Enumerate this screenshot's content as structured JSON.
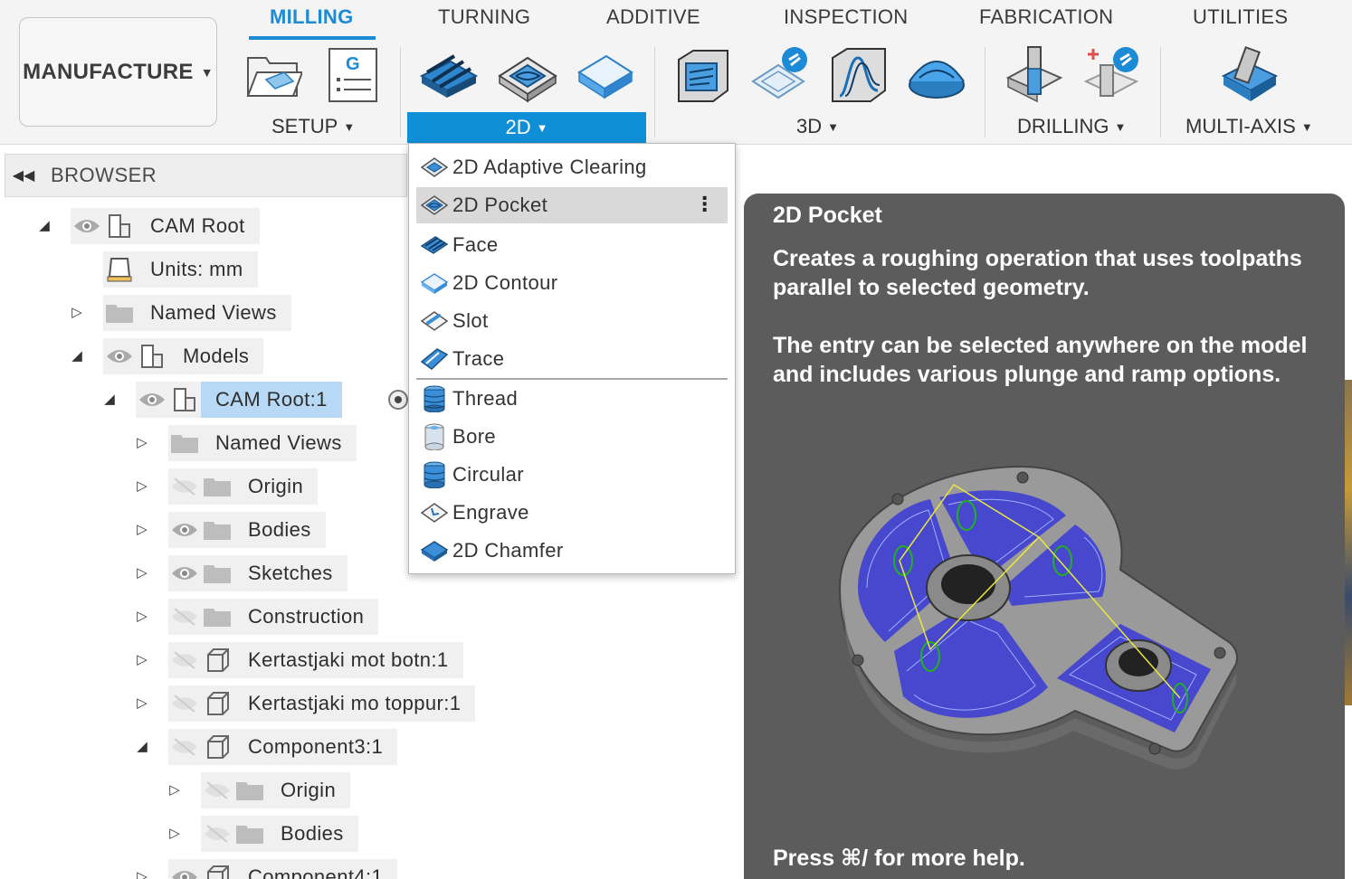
{
  "toolbar": {
    "workspace": "MANUFACTURE",
    "tabs": [
      "MILLING",
      "TURNING",
      "ADDITIVE",
      "INSPECTION",
      "FABRICATION",
      "UTILITIES"
    ],
    "active_tab": "MILLING",
    "groups": {
      "setup": "SETUP",
      "two_d": "2D",
      "three_d": "3D",
      "drilling": "DRILLING",
      "multi_axis": "MULTI-AXIS"
    },
    "accent_color": "#0f8fd6"
  },
  "browser": {
    "title": "BROWSER",
    "nodes": [
      {
        "label": "CAM Root"
      },
      {
        "label": "Units: mm"
      },
      {
        "label": "Named Views"
      },
      {
        "label": "Models"
      },
      {
        "label": "CAM Root:1"
      },
      {
        "label": "Named Views"
      },
      {
        "label": "Origin"
      },
      {
        "label": "Bodies"
      },
      {
        "label": "Sketches"
      },
      {
        "label": "Construction"
      },
      {
        "label": "Kertastjaki mot botn:1"
      },
      {
        "label": "Kertastjaki mo toppur:1"
      },
      {
        "label": "Component3:1"
      },
      {
        "label": "Origin"
      },
      {
        "label": "Bodies"
      },
      {
        "label": "Component4:1"
      }
    ]
  },
  "menu": {
    "items": [
      {
        "label": "2D Adaptive Clearing",
        "icon": "adaptive-clearing-icon"
      },
      {
        "label": "2D Pocket",
        "icon": "pocket-icon",
        "highlighted": true
      },
      {
        "label": "Face",
        "icon": "face-icon"
      },
      {
        "label": "2D Contour",
        "icon": "contour-icon"
      },
      {
        "label": "Slot",
        "icon": "slot-icon"
      },
      {
        "label": "Trace",
        "icon": "trace-icon"
      },
      {
        "label": "Thread",
        "icon": "thread-icon"
      },
      {
        "label": "Bore",
        "icon": "bore-icon"
      },
      {
        "label": "Circular",
        "icon": "circular-icon"
      },
      {
        "label": "Engrave",
        "icon": "engrave-icon"
      },
      {
        "label": "2D Chamfer",
        "icon": "chamfer-icon"
      }
    ]
  },
  "tooltip": {
    "title": "2D Pocket",
    "para1": "Creates a roughing operation that uses toolpaths parallel to selected geometry.",
    "para2": "The entry can be selected anywhere on the model and includes various plunge and ramp options.",
    "help": "Press ⌘/ for more help."
  }
}
